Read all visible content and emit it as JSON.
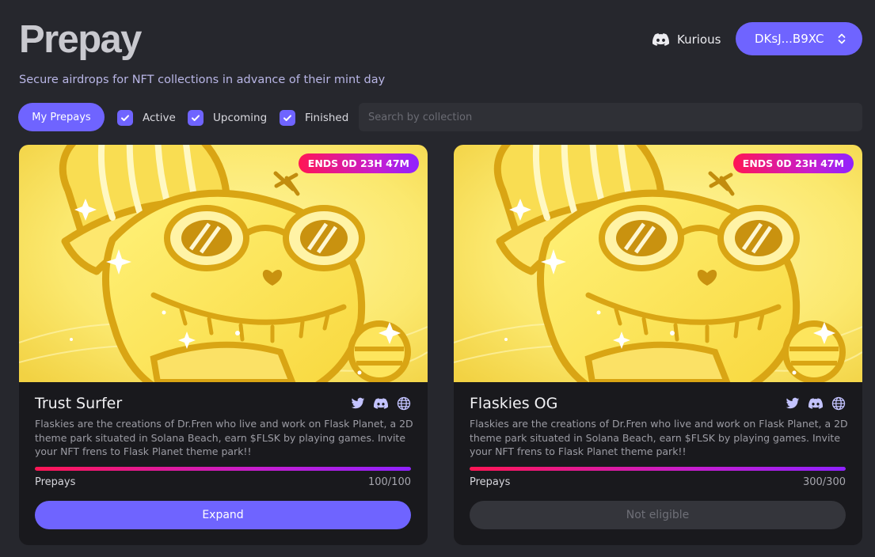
{
  "header": {
    "title": "Prepay",
    "subtitle": "Secure airdrops for NFT collections in advance of their mint day",
    "discord_username": "Kurious",
    "wallet_address": "DKsJ...B9XC"
  },
  "filters": {
    "my_prepays_label": "My Prepays",
    "options": [
      {
        "label": "Active",
        "checked": true
      },
      {
        "label": "Upcoming",
        "checked": true
      },
      {
        "label": "Finished",
        "checked": true
      }
    ],
    "search_placeholder": "Search by collection"
  },
  "cards": [
    {
      "timer": "ENDS 0D 23H 47M",
      "title": "Trust Surfer",
      "description": "Flaskies are the creations of Dr.Fren who live and work on Flask Planet, a 2D theme park situated in Solana Beach, earn $FLSK by playing games. Invite your NFT frens to Flask Planet theme park!!",
      "prepays_label": "Prepays",
      "prepays_count": "100/100",
      "progress": 1.0,
      "button_label": "Expand",
      "button_state": "enabled"
    },
    {
      "timer": "ENDS 0D 23H 47M",
      "title": "Flaskies OG",
      "description": "Flaskies are the creations of Dr.Fren who live and work on Flask Planet, a 2D theme park situated in Solana Beach, earn $FLSK by playing games. Invite your NFT frens to Flask Planet theme park!!",
      "prepays_label": "Prepays",
      "prepays_count": "300/300",
      "progress": 1.0,
      "button_label": "Not eligible",
      "button_state": "disabled"
    }
  ],
  "icons": {
    "discord_header": "discord-icon",
    "wallet_chevron": "chevron-up-down-icon",
    "checkbox_check": "check-icon",
    "card_socials": [
      "twitter-icon",
      "discord-icon",
      "globe-icon"
    ]
  },
  "colors": {
    "background": "#26272d",
    "card_background": "#19191d",
    "accent": "#6f64ff",
    "gradient_start": "#ff1654",
    "gradient_end": "#8f22ff",
    "disabled_button": "#34353b"
  }
}
